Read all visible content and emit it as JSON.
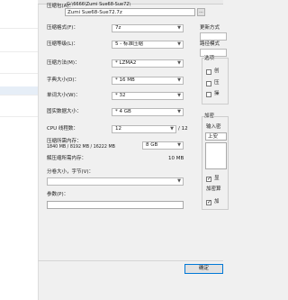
{
  "dialog": {
    "archive_label": "压缩包(A)：",
    "archive_path": "G:\\6666\\Zumi Sue68-Sue72\\",
    "archive_name": "Zumi Sue68-Sue72.7z",
    "format_label": "压缩格式(F)：",
    "format_value": "7z",
    "level_label": "压缩等级(L)：",
    "level_value": "5 - 标准压缩",
    "method_label": "压缩方法(M)：",
    "method_value": "* LZMA2",
    "dict_label": "字典大小(D)：",
    "dict_value": "* 16 MB",
    "word_label": "单词大小(W)：",
    "word_value": "* 32",
    "solid_label": "固实数据大小：",
    "solid_value": "* 4 GB",
    "cpu_label": "CPU 线程数：",
    "cpu_value": "12",
    "cpu_total": "/ 12",
    "mem_compress_label": "压缩所需内存：",
    "mem_compress_detail": "1840 MB / 8192 MB / 16222 MB",
    "mem_limit_value": "8 GB",
    "mem_decompress_label": "解压缩所需内存：",
    "mem_decompress_value": "10 MB",
    "split_label": "分卷大小，字节(V)：",
    "split_value": "",
    "params_label": "参数(P)：",
    "params_value": ""
  },
  "right_panel": {
    "update_mode_label": "更新方式",
    "path_mode_label": "路径模式",
    "options_label": "选项",
    "option_1": "创",
    "option_2": "压",
    "option_3": "操",
    "encrypt_label": "加密",
    "encrypt_input_label": "输入密",
    "encrypt_input_value": "上安",
    "show_password_label": "显",
    "method_label": "加密算",
    "encrypt_filenames_label": "加"
  },
  "buttons": {
    "ok_label": "确定",
    "browse_label": "..."
  }
}
